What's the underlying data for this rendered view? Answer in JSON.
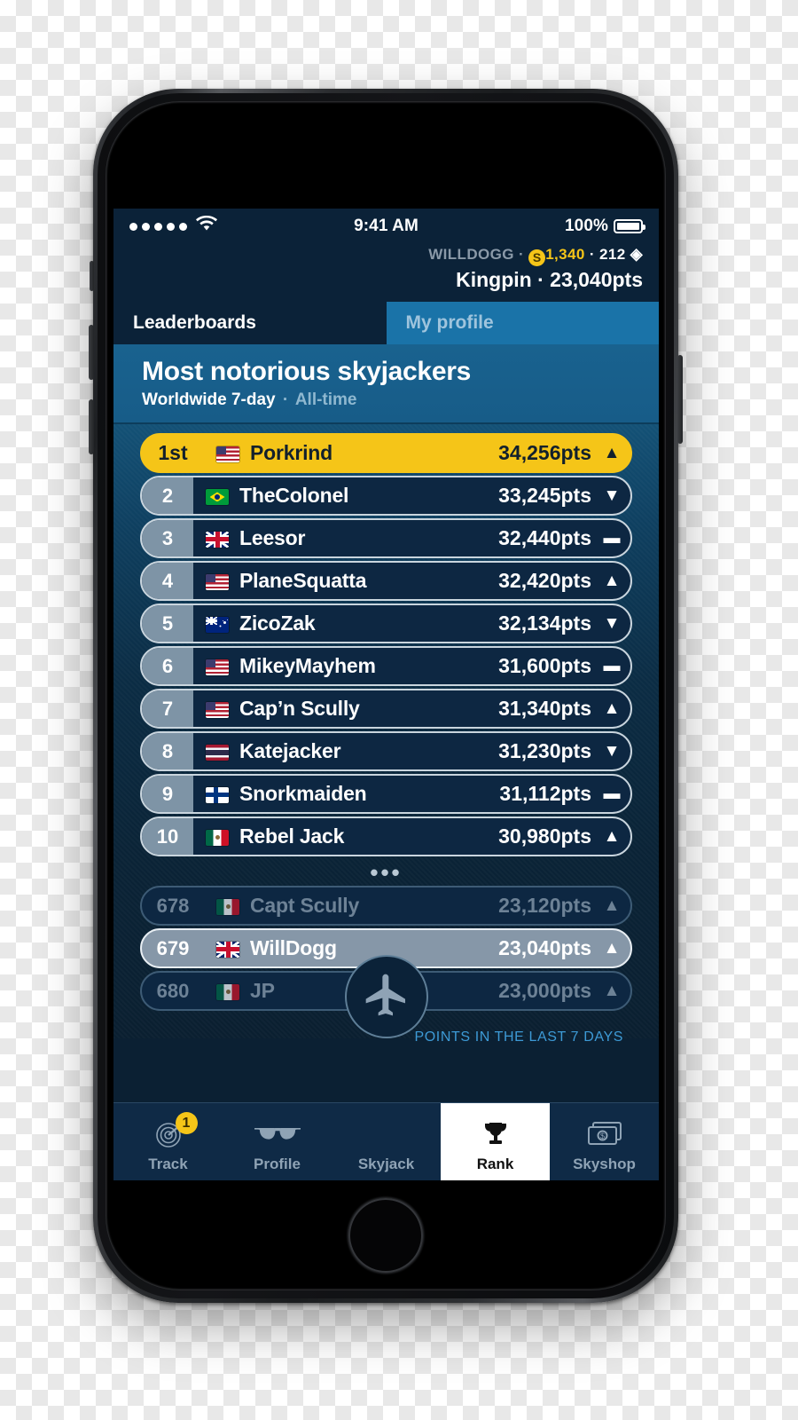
{
  "status_bar": {
    "signal_icon": "signal-dots-icon",
    "wifi_icon": "wifi-icon",
    "time": "9:41 AM",
    "battery_percent": "100%",
    "battery_icon": "battery-full-icon"
  },
  "account": {
    "username": "WILLDOGG",
    "sep1": " · ",
    "coin_icon": "coin-icon",
    "coin_glyph": "S",
    "coins": "1,340",
    "sep2": " · ",
    "gems": "212",
    "gem_icon": "gem-icon",
    "gem_glyph": "◈",
    "rank_title": "Kingpin · 23,040pts"
  },
  "tabs": [
    {
      "label": "Leaderboards",
      "active": true
    },
    {
      "label": "My profile",
      "active": false
    }
  ],
  "banner": {
    "title": "Most notorious skyjackers",
    "filter_active": "Worldwide 7-day",
    "filter_sep": "·",
    "filter_inactive": "All-time"
  },
  "leaderboard": {
    "ellipsis": "•••",
    "footnote": "POINTS IN THE LAST 7 DAYS",
    "rows": [
      {
        "rank": "1st",
        "flag": "us",
        "name": "Porkrind",
        "points": "34,256pts",
        "trend": "▲",
        "style": "first"
      },
      {
        "rank": "2",
        "flag": "br",
        "name": "TheColonel",
        "points": "33,245pts",
        "trend": "▼",
        "style": "normal"
      },
      {
        "rank": "3",
        "flag": "gb",
        "name": "Leesor",
        "points": "32,440pts",
        "trend": "▬",
        "style": "normal"
      },
      {
        "rank": "4",
        "flag": "us",
        "name": "PlaneSquatta",
        "points": "32,420pts",
        "trend": "▲",
        "style": "normal"
      },
      {
        "rank": "5",
        "flag": "au",
        "name": "ZicoZak",
        "points": "32,134pts",
        "trend": "▼",
        "style": "normal"
      },
      {
        "rank": "6",
        "flag": "us",
        "name": "MikeyMayhem",
        "points": "31,600pts",
        "trend": "▬",
        "style": "normal"
      },
      {
        "rank": "7",
        "flag": "us",
        "name": "Cap’n Scully",
        "points": "31,340pts",
        "trend": "▲",
        "style": "normal"
      },
      {
        "rank": "8",
        "flag": "th",
        "name": "Katejacker",
        "points": "31,230pts",
        "trend": "▼",
        "style": "normal"
      },
      {
        "rank": "9",
        "flag": "fi",
        "name": "Snorkmaiden",
        "points": "31,112pts",
        "trend": "▬",
        "style": "normal"
      },
      {
        "rank": "10",
        "flag": "mx",
        "name": "Rebel Jack",
        "points": "30,980pts",
        "trend": "▲",
        "style": "normal"
      }
    ],
    "nearby_rows": [
      {
        "rank": "678",
        "flag": "mx",
        "name": "Capt Scully",
        "points": "23,120pts",
        "trend": "▲",
        "style": "dim"
      },
      {
        "rank": "679",
        "flag": "gb",
        "name": "WillDogg",
        "points": "23,040pts",
        "trend": "▲",
        "style": "self"
      },
      {
        "rank": "680",
        "flag": "mx",
        "name": "JP",
        "points": "23,000pts",
        "trend": "▲",
        "style": "dim"
      }
    ]
  },
  "tab_bar": {
    "items": [
      {
        "label": "Track",
        "icon": "radar-icon",
        "active": false,
        "badge": "1"
      },
      {
        "label": "Profile",
        "icon": "sunglasses-icon",
        "active": false,
        "badge": ""
      },
      {
        "label": "Skyjack",
        "icon": "airplane-icon",
        "active": false,
        "badge": ""
      },
      {
        "label": "Rank",
        "icon": "trophy-icon",
        "active": true,
        "badge": ""
      },
      {
        "label": "Skyshop",
        "icon": "money-icon",
        "active": false,
        "badge": ""
      }
    ]
  },
  "colors": {
    "accent_yellow": "#f5c518",
    "banner_blue": "#19628f",
    "tab_blue": "#1a73a8",
    "navy": "#0b2238",
    "footnote_blue": "#3d9ad6"
  }
}
